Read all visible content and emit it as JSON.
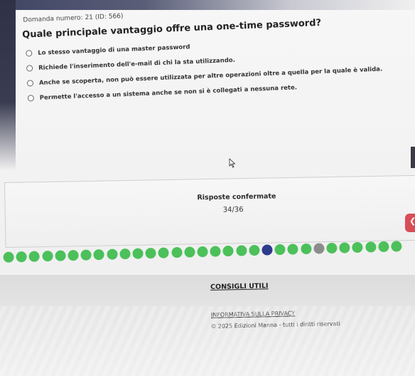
{
  "question": {
    "number_text": "Domanda numero: 21 (ID: 566)",
    "title": "Quale principale vantaggio offre una one-time password?",
    "options": [
      {
        "label": "Lo stesso vantaggio di una master password"
      },
      {
        "label": "Richiede l'inserimento dell'e-mail di chi la sta utilizzando."
      },
      {
        "label": "Anche se scoperta, non può essere utilizzata per altre operazioni oltre a quella per la quale è valida."
      },
      {
        "label": "Permette l'accesso a un sistema anche se non si è collegati a nessuna rete."
      }
    ]
  },
  "stats": {
    "label": "Risposte confermate",
    "value": "34/36"
  },
  "progress": {
    "colors": {
      "confirmed": "#4cc05a",
      "current": "#2e3b8c",
      "skipped": "#8c8c8c"
    },
    "states": [
      "confirmed",
      "confirmed",
      "confirmed",
      "confirmed",
      "confirmed",
      "confirmed",
      "confirmed",
      "confirmed",
      "confirmed",
      "confirmed",
      "confirmed",
      "confirmed",
      "confirmed",
      "confirmed",
      "confirmed",
      "confirmed",
      "confirmed",
      "confirmed",
      "confirmed",
      "confirmed",
      "current",
      "confirmed",
      "confirmed",
      "confirmed",
      "skipped",
      "confirmed",
      "confirmed",
      "confirmed",
      "confirmed",
      "confirmed",
      "confirmed"
    ]
  },
  "footer": {
    "title": "CONSIGLI UTILI",
    "privacy_link": "INFORMATIVA SULLA PRIVACY",
    "copyright": "© 2025 Edizioni Manna - tutti i diritti riservati"
  },
  "icons": {
    "next_button": "chevron-left-icon",
    "cursor": "mouse-pointer-icon"
  },
  "accent_color": "#d94d55"
}
